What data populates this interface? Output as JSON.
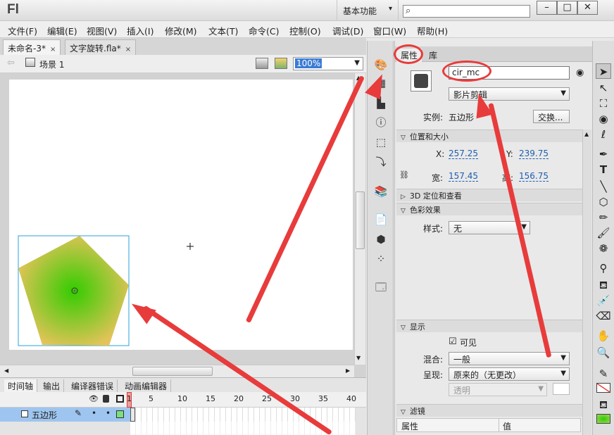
{
  "titlebar": {
    "logo": "Fl",
    "workspace": "基本功能",
    "workspace_arrow": "▾",
    "search_icon": "⌕",
    "min": "–",
    "max": "□",
    "close": "✕"
  },
  "menu": [
    "文件(F)",
    "编辑(E)",
    "视图(V)",
    "插入(I)",
    "修改(M)",
    "文本(T)",
    "命令(C)",
    "控制(O)",
    "调试(D)",
    "窗口(W)",
    "帮助(H)"
  ],
  "doc_tabs": [
    {
      "label": "未命名-3*",
      "close": "×"
    },
    {
      "label": "文字旋转.fla*",
      "close": "×"
    }
  ],
  "scene": {
    "back_arrow": "⇦",
    "name": "场景 1",
    "zoom": "100%"
  },
  "timeline": {
    "tabs": [
      "时间轴",
      "输出",
      "编译器错误",
      "动画编辑器"
    ],
    "frame_numbers": [
      "1",
      "5",
      "10",
      "15",
      "20",
      "25",
      "30",
      "35",
      "40"
    ],
    "header_icons": [
      "eye-icon",
      "lock-icon",
      "outline-icon"
    ],
    "layer": {
      "name": "五边形"
    }
  },
  "props": {
    "tabs": [
      "属性",
      "库"
    ],
    "instance_name": "cir_mc",
    "symbol_type": "影片剪辑",
    "instance_label": "实例:",
    "instance_value": "五边形",
    "swap_button": "交换...",
    "sections": {
      "position": "位置和大小",
      "threed": "3D 定位和查看",
      "color": "色彩效果",
      "display": "显示",
      "filters": "滤镜"
    },
    "x_label": "X:",
    "x_value": "257.25",
    "y_label": "Y:",
    "y_value": "239.75",
    "w_label": "宽:",
    "w_value": "157.45",
    "h_label": "高:",
    "h_value": "156.75",
    "style_label": "样式:",
    "style_value": "无",
    "visible_checkbox": "☑",
    "visible_label": "可见",
    "blend_label": "混合:",
    "blend_value": "一般",
    "render_label": "呈现:",
    "render_value": "原来的（无更改）",
    "transparent_value": "透明",
    "filters_col1": "属性",
    "filters_col2": "值"
  },
  "colors": {
    "accent": "#e83b3b",
    "selection": "#3a7bd5",
    "layer_row": "#9ec5ef",
    "pentagon_center": "#33cc00",
    "pentagon_edge": "#e6c35a"
  }
}
